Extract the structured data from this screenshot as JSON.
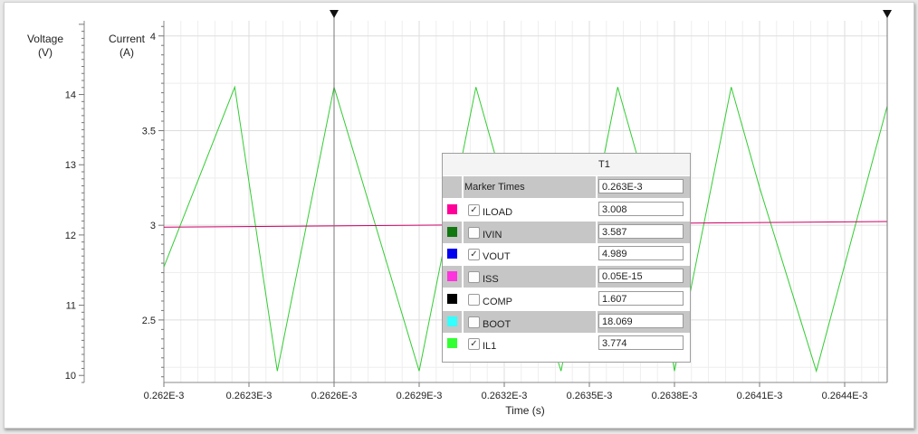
{
  "axes": {
    "left_title": [
      "Voltage",
      "(V)"
    ],
    "right_title": [
      "Current",
      "(A)"
    ],
    "x_title": "Time (s)"
  },
  "chart_data": {
    "type": "line",
    "x_unit": "s",
    "xlim": [
      0.000262,
      0.00026455
    ],
    "x_ticks": [
      0.000262,
      0.0002623,
      0.0002626,
      0.0002629,
      0.0002632,
      0.0002635,
      0.0002638,
      0.0002641,
      0.0002644
    ],
    "x_tick_labels": [
      "0.262E-3",
      "0.2623E-3",
      "0.2626E-3",
      "0.2629E-3",
      "0.2632E-3",
      "0.2635E-3",
      "0.2638E-3",
      "0.2641E-3",
      "0.2644E-3"
    ],
    "y_axes": [
      {
        "title": "Voltage (V)",
        "ylim": [
          9.9,
          15.05
        ],
        "ticks": [
          10,
          11,
          12,
          13,
          14
        ],
        "tick_labels": [
          "10",
          "11",
          "12",
          "13",
          "14"
        ]
      },
      {
        "title": "Current (A)",
        "ylim": [
          2.17,
          4.08
        ],
        "ticks": [
          2.5,
          3,
          3.5,
          4
        ],
        "tick_labels": [
          "2.5",
          "3",
          "3.5",
          "4"
        ]
      }
    ],
    "grid": true,
    "series": [
      {
        "name": "IL1",
        "color": "#33cc33",
        "axis": 1,
        "x": [
          0.000262,
          0.00026225,
          0.0002624,
          0.0002626,
          0.0002629,
          0.0002631,
          0.0002632,
          0.0002634,
          0.0002636,
          0.0002637,
          0.0002638,
          0.000264,
          0.0002641,
          0.0002643,
          0.00026455
        ],
        "y": [
          2.78,
          3.73,
          2.23,
          3.73,
          2.23,
          3.73,
          3.2,
          2.23,
          3.73,
          3.2,
          2.23,
          3.73,
          3.2,
          2.23,
          3.63
        ]
      },
      {
        "name": "VOUT",
        "color": "#cc0066",
        "axis": 1,
        "x": [
          0.000262,
          0.00026455
        ],
        "y": [
          2.99,
          3.02
        ]
      }
    ],
    "markers": [
      {
        "name": "T1",
        "x": 0.0002626
      },
      {
        "name": "",
        "x": 0.00026455
      }
    ]
  },
  "marker_panel": {
    "column_header": "T1",
    "time_label": "Marker Times",
    "time_value": "0.263E-3",
    "rows": [
      {
        "name": "ILOAD",
        "color": "#ff0099",
        "checked": true,
        "value": "3.008"
      },
      {
        "name": "IVIN",
        "color": "#117711",
        "checked": false,
        "value": "3.587"
      },
      {
        "name": "VOUT",
        "color": "#0000ee",
        "checked": true,
        "value": "4.989"
      },
      {
        "name": "ISS",
        "color": "#ff33dd",
        "checked": false,
        "value": "0.05E-15"
      },
      {
        "name": "COMP",
        "color": "#000000",
        "checked": false,
        "value": "1.607"
      },
      {
        "name": "BOOT",
        "color": "#33ffff",
        "checked": false,
        "value": "18.069"
      },
      {
        "name": "IL1",
        "color": "#33ff33",
        "checked": true,
        "value": "3.774"
      }
    ]
  }
}
